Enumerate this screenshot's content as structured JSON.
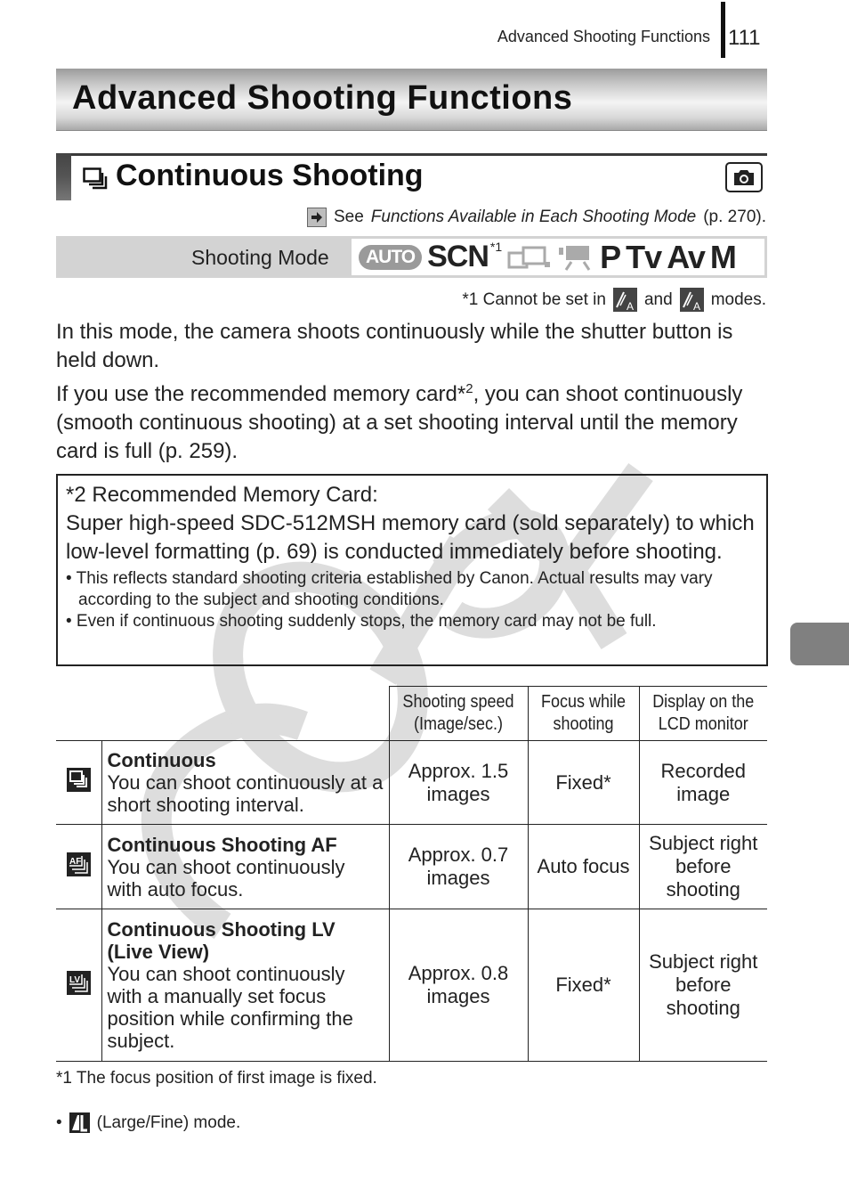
{
  "running_header": {
    "section": "Advanced Shooting Functions",
    "page_number": "111"
  },
  "chapter": {
    "title": "Advanced Shooting Functions"
  },
  "section": {
    "icon": "continuous-shooting-icon",
    "title": "Continuous Shooting",
    "mode_icon": "camera-icon",
    "see_ref": {
      "icon": "arrow-right-icon",
      "prefix": "See",
      "link_text": "Functions Available in Each Shooting Mode",
      "page": "(p. 270)."
    }
  },
  "shooting_mode": {
    "label": "Shooting Mode",
    "modes": [
      {
        "name": "AUTO",
        "available": false
      },
      {
        "name": "SCN",
        "available": true,
        "note": "*1"
      },
      {
        "name": "stitch-assist",
        "available": false
      },
      {
        "name": "movie",
        "available": false
      },
      {
        "name": "P",
        "available": true
      },
      {
        "name": "Tv",
        "available": true
      },
      {
        "name": "Av",
        "available": true
      },
      {
        "name": "M",
        "available": true
      }
    ],
    "note": {
      "prefix": "*1 Cannot be set in",
      "conjunction": "and",
      "suffix": "modes.",
      "icons": [
        "color-accent-icon",
        "color-swap-icon"
      ]
    }
  },
  "body": {
    "paragraph1": "In this mode, the camera shoots continuously while the shutter button is held down.",
    "paragraph2_before": "If you use the recommended memory card*",
    "paragraph2_sup": "2",
    "paragraph2_after": ", you can shoot continuously (smooth continuous shooting) at a set shooting interval until the memory card is full (p. 259)."
  },
  "memory_card_note": {
    "heading": "*2 Recommended Memory Card:",
    "body": "Super high-speed SDC-512MSH memory card (sold separately) to which low-level formatting (p. 69) is conducted immediately before shooting.",
    "bullets": [
      "• This reflects standard shooting criteria established by Canon. Actual results may vary according to the subject and shooting conditions.",
      "• Even if continuous shooting suddenly stops, the memory card may not be full."
    ]
  },
  "table": {
    "headers": [
      "Shooting speed (Image/sec.)",
      "Focus while shooting",
      "Display on the LCD monitor"
    ],
    "rows": [
      {
        "icon": "continuous-icon",
        "title": "Continuous",
        "description": "You can shoot continuously at a short shooting interval.",
        "speed": "Approx. 1.5 images",
        "focus": "Fixed*",
        "display": "Recorded image"
      },
      {
        "icon": "continuous-af-icon",
        "title": "Continuous Shooting AF",
        "description": "You can shoot continuously with auto focus.",
        "speed": "Approx. 0.7 images",
        "focus": "Auto focus",
        "display": "Subject right before shooting"
      },
      {
        "icon": "continuous-lv-icon",
        "title": "Continuous Shooting LV (Live View)",
        "description": "You can shoot continuously with a manually set focus position while confirming the subject.",
        "speed": "Approx. 0.8 images",
        "focus": "Fixed*",
        "display": "Subject right before shooting"
      }
    ]
  },
  "footnotes": {
    "focus_note": "*1 The focus position of first image is fixed.",
    "bullet": "•",
    "large_fine_text": "(Large/Fine) mode."
  },
  "watermark": {
    "text": "COPY"
  },
  "colors": {
    "text": "#222222",
    "mode_bar": "#d3d3d3",
    "side_tab": "#808080",
    "watermark": "#cfcfcf"
  }
}
